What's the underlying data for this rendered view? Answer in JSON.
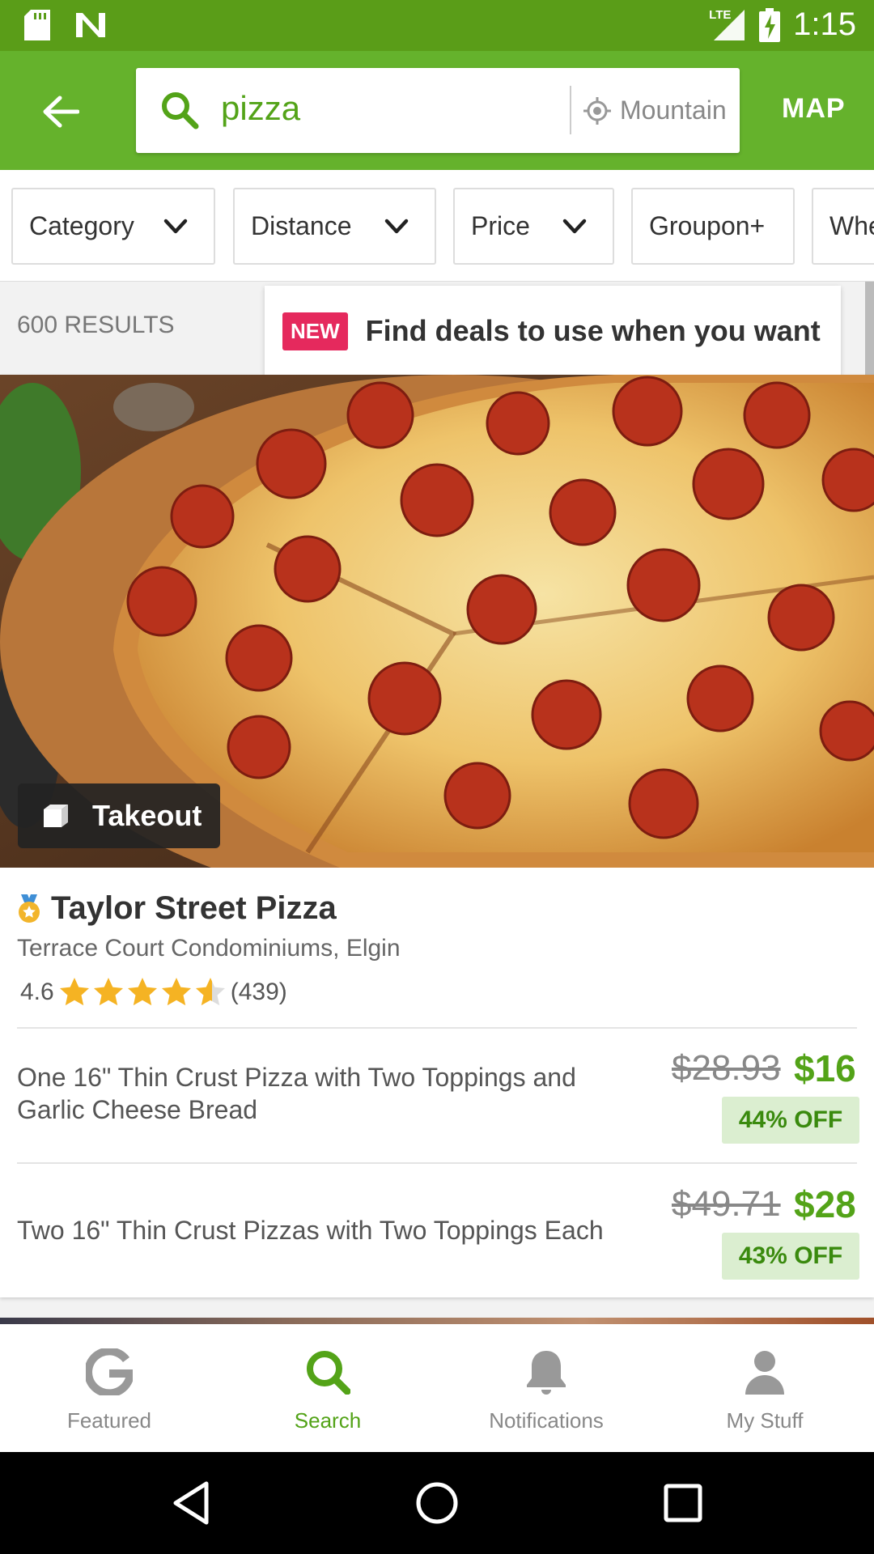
{
  "status_bar": {
    "time": "1:15",
    "network": "LTE"
  },
  "header": {
    "search_query": "pizza",
    "location_text": "Mountain",
    "map_label": "MAP"
  },
  "filters": [
    {
      "label": "Category",
      "has_dropdown": true
    },
    {
      "label": "Distance",
      "has_dropdown": true
    },
    {
      "label": "Price",
      "has_dropdown": true
    },
    {
      "label": "Groupon+",
      "has_dropdown": false
    },
    {
      "label": "Whe",
      "has_dropdown": false
    }
  ],
  "results": {
    "count_label": "600 RESULTS"
  },
  "tooltip": {
    "badge": "NEW",
    "text": "Find deals to use when you want"
  },
  "deal": {
    "badge_label": "Takeout",
    "merchant_name": "Taylor Street Pizza",
    "location": "Terrace Court Condominiums, Elgin",
    "rating": "4.6",
    "rating_value": 4.6,
    "review_count": "(439)",
    "options": [
      {
        "title_line1": "One 16\" Thin Crust Pizza with Two Toppings and",
        "title_line2": "Garlic Cheese Bread",
        "old_price": "$28.93",
        "new_price": "$16",
        "discount": "44% OFF"
      },
      {
        "title_line1": "Two 16\" Thin Crust Pizzas with Two Toppings Each",
        "title_line2": "",
        "old_price": "$49.71",
        "new_price": "$28",
        "discount": "43% OFF"
      }
    ]
  },
  "bottom_nav": [
    {
      "label": "Featured",
      "icon": "groupon-g-icon",
      "active": false
    },
    {
      "label": "Search",
      "icon": "search-icon",
      "active": true
    },
    {
      "label": "Notifications",
      "icon": "bell-icon",
      "active": false
    },
    {
      "label": "My Stuff",
      "icon": "person-icon",
      "active": false
    }
  ],
  "colors": {
    "brand_green": "#65b22c",
    "status_bar_green": "#5a9d18",
    "price_green": "#53a318",
    "new_badge_red": "#e5295d"
  }
}
